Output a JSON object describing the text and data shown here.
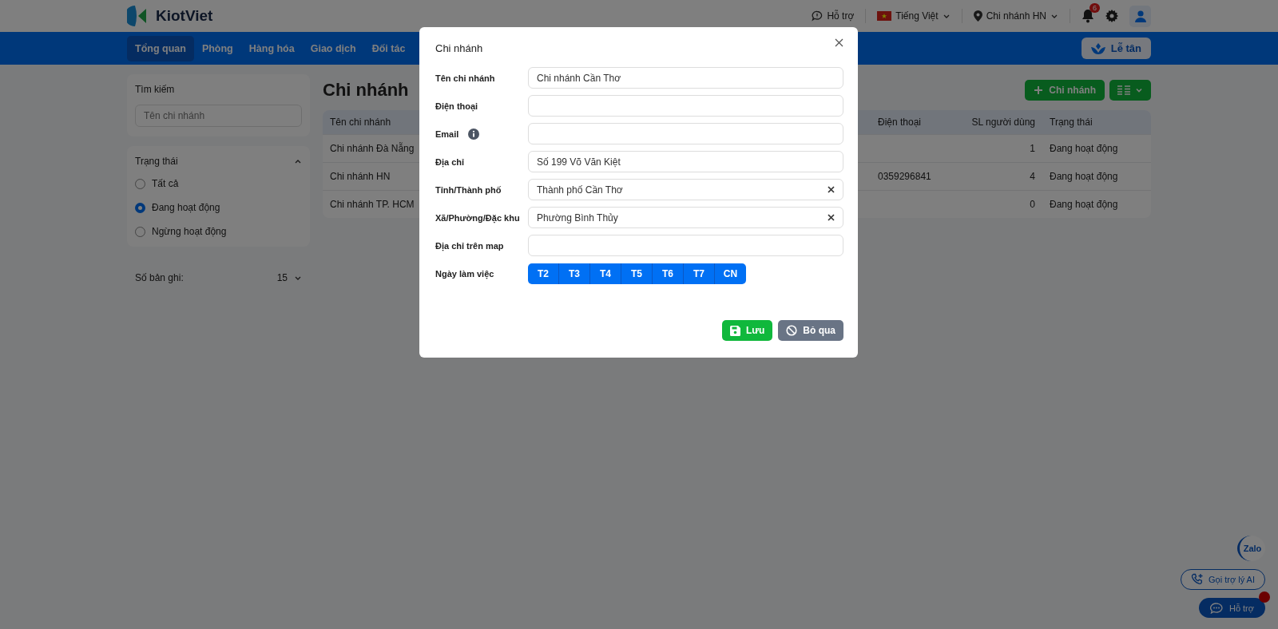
{
  "header": {
    "logo": "KiotViet",
    "help": "Hỗ trợ",
    "language": "Tiếng Việt",
    "branch": "Chi nhánh HN",
    "notification_count": "6"
  },
  "nav": {
    "items": [
      {
        "label": "Tổng quan",
        "selected": true
      },
      {
        "label": "Phòng",
        "selected": false
      },
      {
        "label": "Hàng hóa",
        "selected": false
      },
      {
        "label": "Giao dịch",
        "selected": false
      },
      {
        "label": "Đối tác",
        "selected": false
      }
    ],
    "reception_button": "Lễ tân"
  },
  "sidebar": {
    "search": {
      "title": "Tìm kiếm",
      "placeholder": "Tên chi nhánh"
    },
    "status": {
      "title": "Trạng thái",
      "expanded": true,
      "options": [
        {
          "label": "Tất cả",
          "selected": false
        },
        {
          "label": "Đang hoạt động",
          "selected": true
        },
        {
          "label": "Ngừng hoạt động",
          "selected": false
        }
      ]
    },
    "page_size": {
      "label": "Số bản ghi:",
      "value": "15"
    }
  },
  "main": {
    "title": "Chi nhánh",
    "add_button": "Chi nhánh",
    "table": {
      "columns": [
        "Tên chi nhánh",
        "Điện thoại",
        "SL người dùng",
        "Trạng thái"
      ],
      "rows": [
        [
          "Chi nhánh Đà Nẵng",
          "",
          "1",
          "Đang hoạt động"
        ],
        [
          "Chi nhánh HN",
          "0359296841",
          "4",
          "Đang hoạt động"
        ],
        [
          "Chi nhánh TP. HCM",
          "",
          "0",
          "Đang hoạt động"
        ]
      ]
    }
  },
  "dialog": {
    "title": "Chi nhánh",
    "fields": [
      {
        "label": "Tên chi nhánh",
        "value": "Chi nhánh Cần Thơ",
        "kind": "text"
      },
      {
        "label": "Điện thoại",
        "kind": "text"
      },
      {
        "label": "Email",
        "kind": "text",
        "info": true
      },
      {
        "label": "Địa chỉ",
        "value": "Số 199 Võ Văn Kiệt",
        "kind": "text"
      },
      {
        "label": "Tỉnh/Thành phố",
        "value": "Thành phố Cần Thơ",
        "kind": "select"
      },
      {
        "label": "Xã/Phường/Đặc khu",
        "value": "Phường Bình Thủy",
        "kind": "select"
      },
      {
        "label": "Địa chỉ trên map",
        "kind": "text"
      }
    ],
    "workdays": {
      "label": "Ngày làm việc",
      "days": [
        {
          "label": "T2",
          "selected": true
        },
        {
          "label": "T3",
          "selected": true
        },
        {
          "label": "T4",
          "selected": true
        },
        {
          "label": "T5",
          "selected": true
        },
        {
          "label": "T6",
          "selected": true
        },
        {
          "label": "T7",
          "selected": true
        },
        {
          "label": "CN",
          "selected": true
        }
      ]
    },
    "save_button": "Lưu",
    "cancel_button": "Bỏ qua"
  },
  "floating": {
    "zalo": "Zalo",
    "ai_button": "Gọi trợ lý AI",
    "help_button": "Hỗ trợ"
  }
}
